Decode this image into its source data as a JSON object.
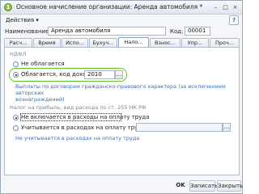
{
  "window": {
    "title": "Основное начисление организации: Аренда автомобиля *",
    "controls": {
      "minimize": "–",
      "maximize": "□",
      "close": "×"
    },
    "app_icon": "1"
  },
  "toolbar": {
    "actions_label": "Действия ▾",
    "help_label": "?"
  },
  "form": {
    "name_label": "Наименование:",
    "name_value": "Аренда автомобиля",
    "code_label": "Код:",
    "code_value": "00001"
  },
  "tabs": [
    {
      "label": "Расч..."
    },
    {
      "label": "Время"
    },
    {
      "label": "Испо..."
    },
    {
      "label": "Бухуч..."
    },
    {
      "label": "Нало..."
    },
    {
      "label": "Взнос..."
    },
    {
      "label": "Упр..."
    },
    {
      "label": "Проч..."
    }
  ],
  "ndfl": {
    "section_title": "НДФЛ",
    "option_not_taxed": "Не облагается",
    "option_taxed": "Облагается, код дохода:",
    "income_code": "2010",
    "dots": "...",
    "note_line1": "Выплаты по договорам гражданско-правового характера (за исключением авторских",
    "note_line2": "вознаграждений)"
  },
  "profit_tax": {
    "section_title": "Налог на прибыль, вид расхода по ст. 255 НК РФ",
    "option_not_included": "Не включается в расходы на оплату труда",
    "option_included": "Учитывается в расходах на оплату труда по:",
    "dots": "...",
    "note": "Не учитывается в расходах на оплату труда"
  },
  "footer": {
    "ok": "OK",
    "save": "Записать",
    "close": "Закрыть"
  },
  "colors": {
    "highlight": "#5ec42a",
    "note_blue": "#3a6fb5",
    "panel_border": "#aebbcc"
  }
}
